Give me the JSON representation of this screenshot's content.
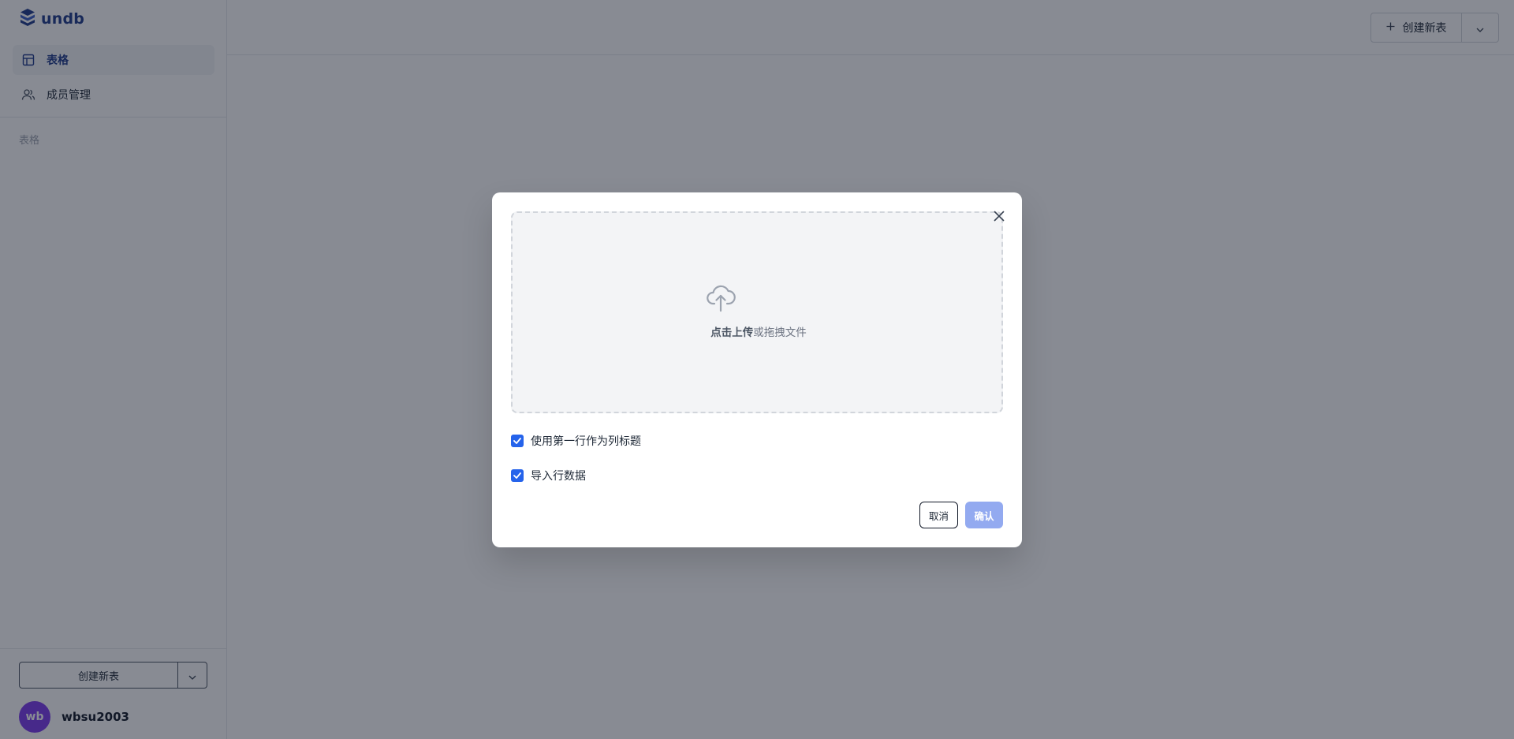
{
  "app": {
    "logo_text": "undb",
    "logo_icon": "cube-stack-icon",
    "brand_color": "#1e3a8a"
  },
  "sidebar": {
    "items": [
      {
        "label": "表格",
        "icon": "table-icon",
        "active": true
      },
      {
        "label": "成员管理",
        "icon": "users-icon",
        "active": false
      }
    ],
    "section_label": "表格",
    "create_button_label": "创建新表",
    "user": {
      "avatar_initials": "wb",
      "username": "wbsu2003",
      "avatar_color": "#7c3aed"
    }
  },
  "topbar": {
    "create_button_label": "创建新表"
  },
  "modal": {
    "upload_strong": "点击上传",
    "upload_rest": "或拖拽文件",
    "options": [
      {
        "label": "使用第一行作为列标题",
        "checked": true
      },
      {
        "label": "导入行数据",
        "checked": true
      }
    ],
    "cancel_label": "取消",
    "confirm_label": "确认",
    "confirm_color": "#93aaf0",
    "checkbox_color": "#2563eb"
  }
}
